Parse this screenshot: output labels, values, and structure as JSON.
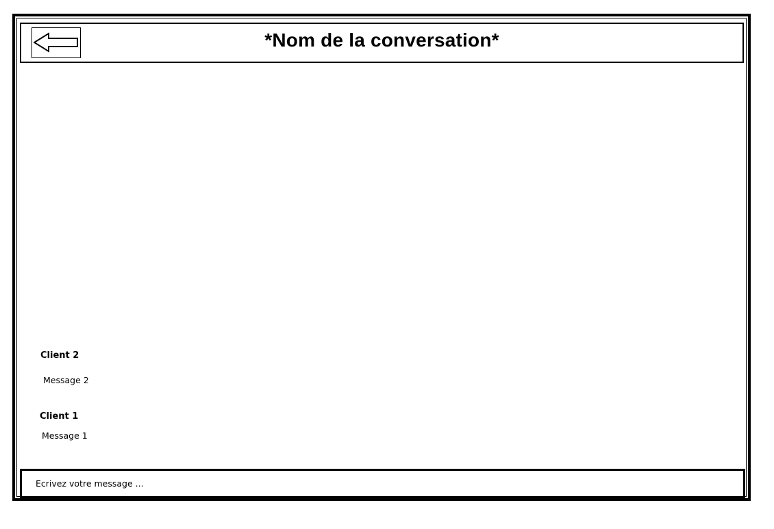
{
  "header": {
    "title": "*Nom de la conversation*",
    "back_icon": "left-arrow-icon"
  },
  "messages": [
    {
      "author": "Client 2",
      "text": "Message 2"
    },
    {
      "author": "Client 1",
      "text": "Message 1"
    }
  ],
  "composer": {
    "placeholder": "Ecrivez votre message ...",
    "value": ""
  },
  "colors": {
    "border": "#000000",
    "background": "#ffffff",
    "text": "#000000"
  }
}
